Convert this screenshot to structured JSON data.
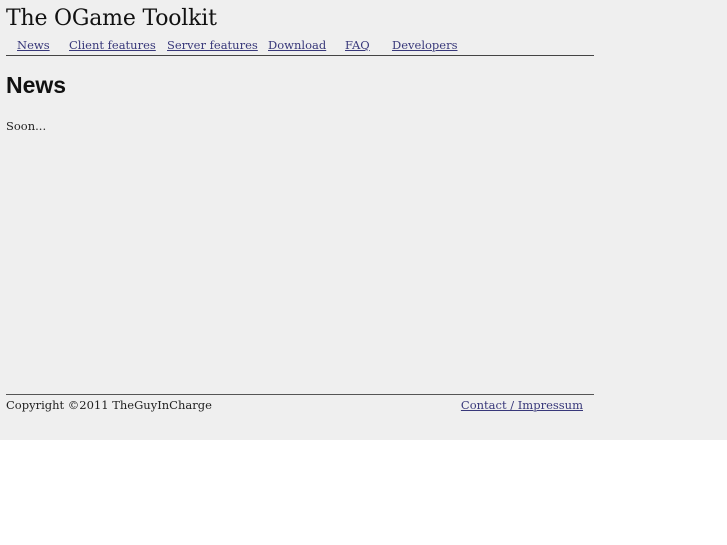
{
  "site": {
    "title": "The OGame Toolkit"
  },
  "nav": {
    "items": [
      {
        "label": "News"
      },
      {
        "label": "Client features"
      },
      {
        "label": "Server features"
      },
      {
        "label": "Download"
      },
      {
        "label": "FAQ"
      },
      {
        "label": "Developers"
      }
    ]
  },
  "main": {
    "heading": "News",
    "text": "Soon..."
  },
  "footer": {
    "copyright": "Copyright ©2011 TheGuyInCharge",
    "contact_label": "Contact / Impressum"
  },
  "colors": {
    "background": "#efefef",
    "link": "#38387a"
  }
}
